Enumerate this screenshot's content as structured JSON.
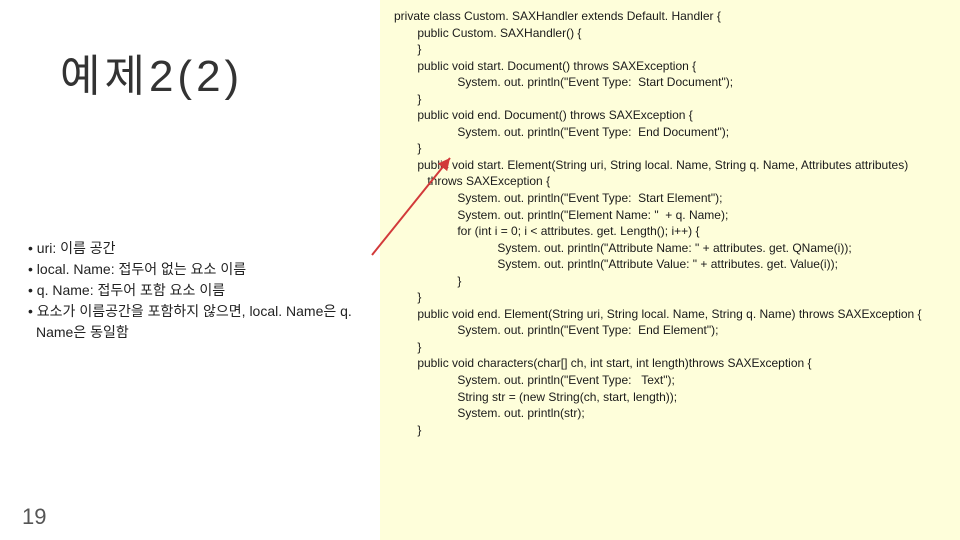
{
  "title": "예제2(2)",
  "bullets": [
    "uri:  이름 공간",
    "local. Name:  접두어 없는 요소 이름",
    "q. Name:  접두어 포함 요소 이름",
    "요소가 이름공간을 포함하지 않으면, local. Name은 q. Name은 동일함"
  ],
  "code": "private class Custom. SAXHandler extends Default. Handler {\n       public Custom. SAXHandler() {\n       }\n       public void start. Document() throws SAXException {\n                   System. out. println(\"Event Type:  Start Document\");\n       }\n       public void end. Document() throws SAXException {\n                   System. out. println(\"Event Type:  End Document\");\n       }\n       public void start. Element(String uri, String local. Name, String q. Name, Attributes attributes)\n          throws SAXException {\n                   System. out. println(\"Event Type:  Start Element\");\n                   System. out. println(\"Element Name: \"  + q. Name);\n                   for (int i = 0; i < attributes. get. Length(); i++) {\n                               System. out. println(\"Attribute Name: \" + attributes. get. QName(i));\n                               System. out. println(\"Attribute Value: \" + attributes. get. Value(i));\n                   }\n       }\n       public void end. Element(String uri, String local. Name, String q. Name) throws SAXException {\n                   System. out. println(\"Event Type:  End Element\");\n       }\n       public void characters(char[] ch, int start, int length)throws SAXException {\n                   System. out. println(\"Event Type:   Text\");\n                   String str = (new String(ch, start, length));\n                   System. out. println(str);\n       }",
  "page_number": "19"
}
